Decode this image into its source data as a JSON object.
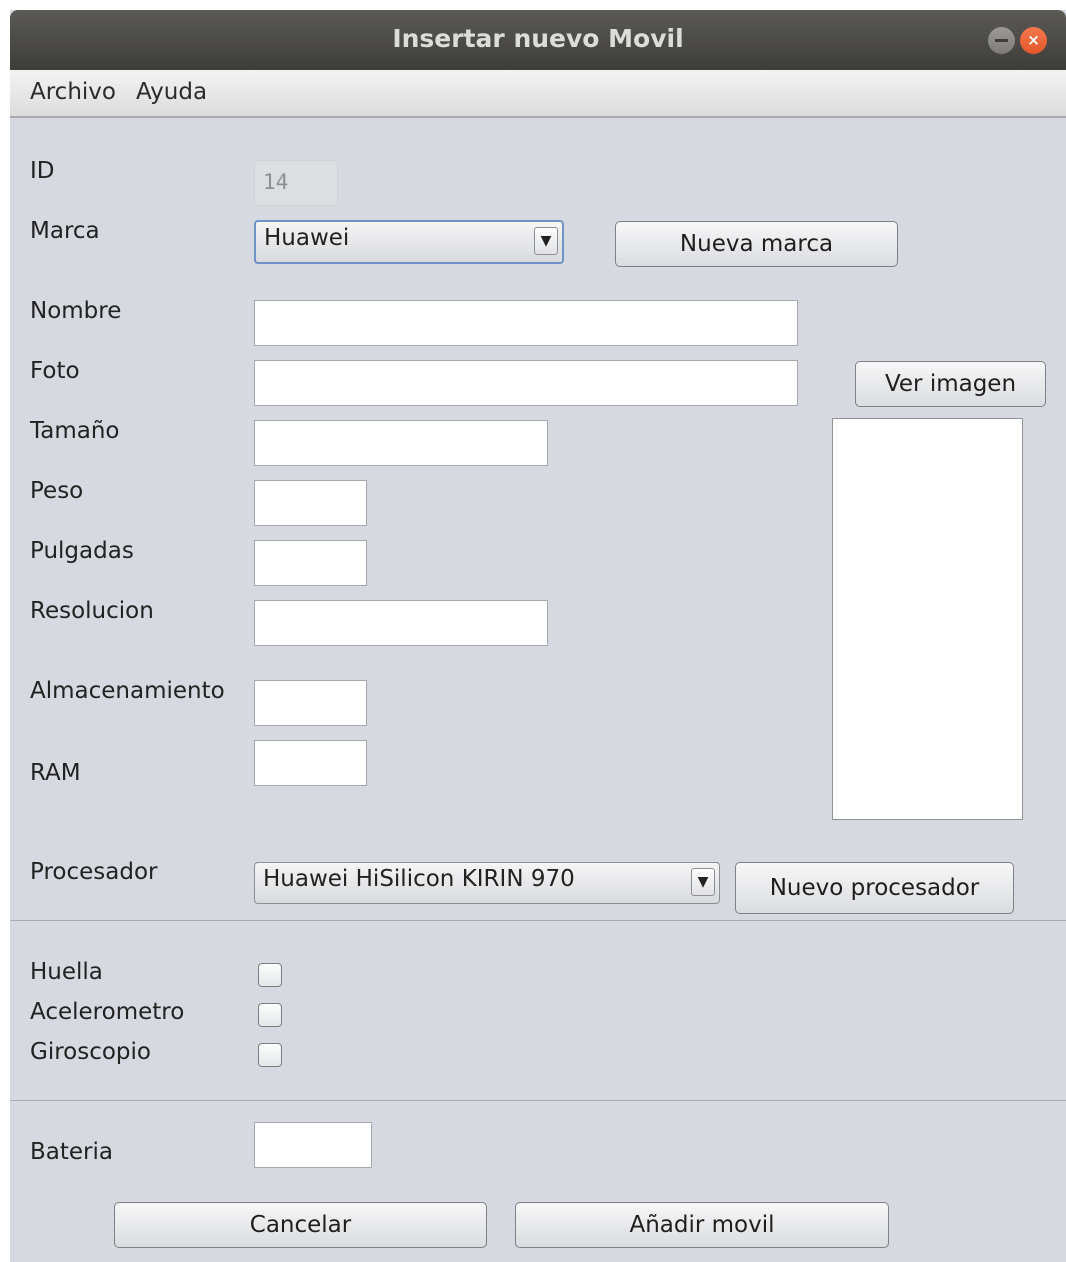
{
  "window": {
    "title": "Insertar nuevo Movil",
    "close_glyph": "×"
  },
  "menu": [
    "Archivo",
    "Ayuda"
  ],
  "form": {
    "id": {
      "label": "ID",
      "value": "14"
    },
    "marca": {
      "label": "Marca",
      "selected": "Huawei",
      "new_button": "Nueva marca"
    },
    "nombre": {
      "label": "Nombre",
      "value": ""
    },
    "foto": {
      "label": "Foto",
      "value": "",
      "view_button": "Ver imagen"
    },
    "tamano": {
      "label": "Tamaño",
      "value": ""
    },
    "peso": {
      "label": "Peso",
      "value": ""
    },
    "pulgadas": {
      "label": "Pulgadas",
      "value": ""
    },
    "resolucion": {
      "label": "Resolucion",
      "value": ""
    },
    "almacenamiento": {
      "label": "Almacenamiento",
      "value": ""
    },
    "ram": {
      "label": "RAM",
      "value": ""
    },
    "procesador": {
      "label": "Procesador",
      "selected": "Huawei HiSilicon KIRIN 970",
      "new_button": "Nuevo procesador"
    },
    "huella": {
      "label": "Huella",
      "checked": false
    },
    "acelerometro": {
      "label": "Acelerometro",
      "checked": false
    },
    "giroscopio": {
      "label": "Giroscopio",
      "checked": false
    },
    "bateria": {
      "label": "Bateria",
      "value": ""
    }
  },
  "actions": {
    "cancel": "Cancelar",
    "add": "Añadir movil"
  },
  "icons": {
    "combo_arrow": "▼"
  },
  "colors": {
    "window_bg": "#d6d9df",
    "titlebar": "#3e3d3a",
    "close": "#e2582a",
    "focus": "#6f93c7"
  }
}
